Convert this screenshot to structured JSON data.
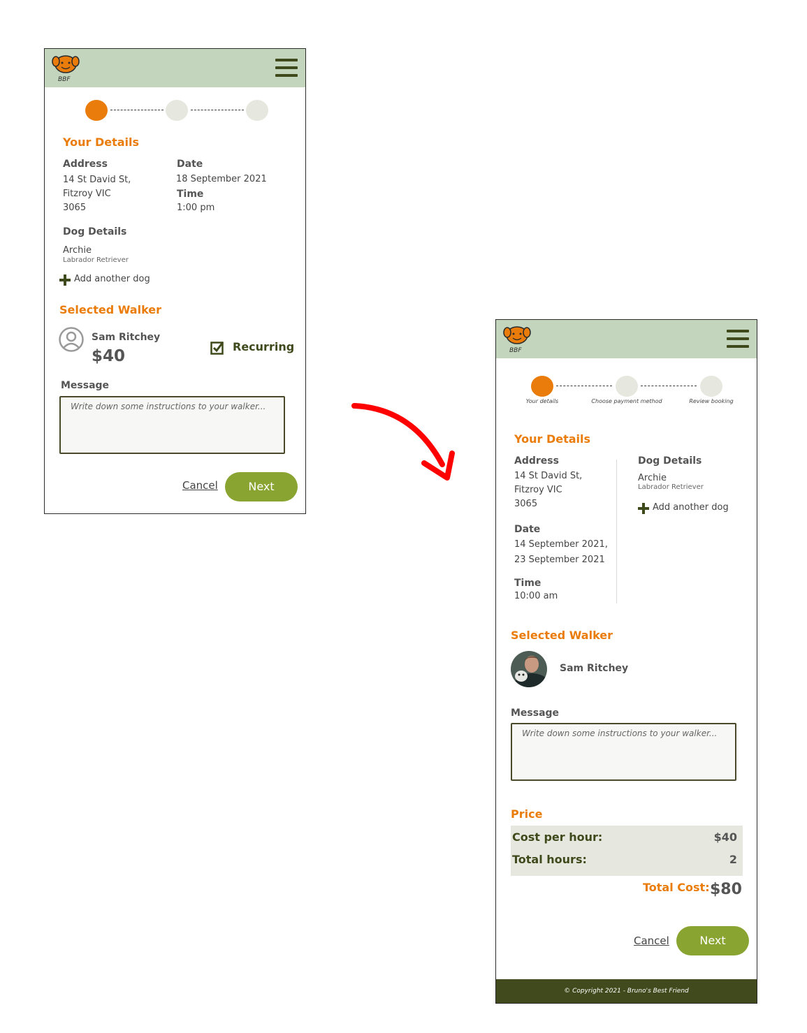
{
  "brand": {
    "logo_text": "BBF"
  },
  "screen_a": {
    "details_title": "Your Details",
    "address_label": "Address",
    "address_value": "14 St David St,\nFitzroy VIC\n3065",
    "date_label": "Date",
    "date_value": "18 September 2021",
    "time_label": "Time",
    "time_value": "1:00 pm",
    "dog_label": "Dog Details",
    "dog_name": "Archie",
    "dog_breed": "Labrador Retriever",
    "add_dog": "Add another dog",
    "walker_title": "Selected Walker",
    "walker_name": "Sam Ritchey",
    "walker_price": "$40",
    "recurring_label": "Recurring",
    "recurring_checked": true,
    "message_label": "Message",
    "message_placeholder": "Write down some instructions to your walker...",
    "cancel_label": "Cancel",
    "next_label": "Next"
  },
  "screen_b": {
    "steps": [
      "Your details",
      "Choose payment method",
      "Review booking"
    ],
    "details_title": "Your Details",
    "address_label": "Address",
    "address_value": "14 St David St,\nFitzroy VIC\n3065",
    "date_label": "Date",
    "date_value": "14 September 2021,\n23 September 2021",
    "time_label": "Time",
    "time_value": "10:00 am",
    "dog_label": "Dog Details",
    "dog_name": "Archie",
    "dog_breed": "Labrador Retriever",
    "add_dog": "Add another dog",
    "walker_title": "Selected Walker",
    "walker_name": "Sam Ritchey",
    "message_label": "Message",
    "message_placeholder": "Write down some instructions to your walker...",
    "price_title": "Price",
    "cost_per_hour_label": "Cost per hour:",
    "cost_per_hour_value": "$40",
    "total_hours_label": "Total hours:",
    "total_hours_value": "2",
    "total_cost_label": "Total Cost:",
    "total_cost_value": "$80",
    "cancel_label": "Cancel",
    "next_label": "Next",
    "footer": "© Copyright 2021 - Bruno's Best Friend"
  },
  "colors": {
    "accent_orange": "#ea7c0b",
    "header_green": "#c3d5bd",
    "button_green": "#8aa431",
    "footer_olive": "#414a1c",
    "arrow_red": "#ff0000"
  },
  "icons": [
    "dog-logo-icon",
    "hamburger-menu-icon",
    "plus-icon",
    "user-avatar-icon",
    "checkbox-checked-icon",
    "arrow-icon"
  ]
}
